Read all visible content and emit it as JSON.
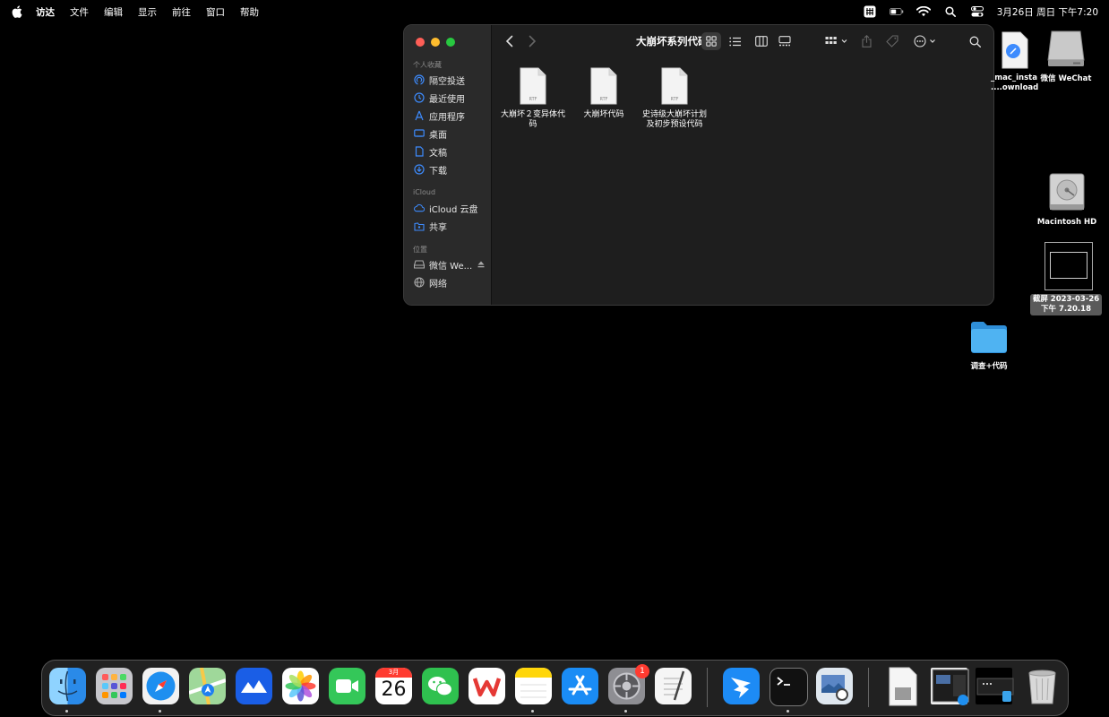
{
  "menubar": {
    "app_name": "访达",
    "menus": [
      "文件",
      "编辑",
      "显示",
      "前往",
      "窗口",
      "帮助"
    ],
    "clock": "3月26日 周日 下午7:20",
    "icons": [
      "apple-icon",
      "input-method-icon",
      "battery-icon",
      "wifi-icon",
      "spotlight-icon",
      "control-center-icon"
    ]
  },
  "finder": {
    "title": "大崩坏系列代码",
    "sidebar": {
      "favorites_header": "个人收藏",
      "favorites": [
        {
          "label": "隔空投送",
          "icon": "airdrop-icon"
        },
        {
          "label": "最近使用",
          "icon": "recents-icon"
        },
        {
          "label": "应用程序",
          "icon": "applications-icon"
        },
        {
          "label": "桌面",
          "icon": "desktop-icon"
        },
        {
          "label": "文稿",
          "icon": "documents-icon"
        },
        {
          "label": "下载",
          "icon": "downloads-icon"
        }
      ],
      "icloud_header": "iCloud",
      "icloud": [
        {
          "label": "iCloud 云盘",
          "icon": "icloud-icon"
        },
        {
          "label": "共享",
          "icon": "shared-folder-icon"
        }
      ],
      "locations_header": "位置",
      "locations": [
        {
          "label": "微信 We...",
          "icon": "disk-icon"
        },
        {
          "label": "网络",
          "icon": "network-icon"
        }
      ]
    },
    "files": [
      {
        "name_line1": "大崩坏２变异体代",
        "name_line2": "码",
        "badge": "RTF"
      },
      {
        "name_line1": "大崩坏代码",
        "name_line2": "",
        "badge": "RTF"
      },
      {
        "name_line1": "史诗级大崩坏计划",
        "name_line2": "及初步预设代码",
        "badge": "RTF"
      }
    ]
  },
  "desktop": {
    "items": [
      {
        "line1": "_mac_insta",
        "line2": "....ownload",
        "icon": "installer-file-icon"
      },
      {
        "line1": "微信 WeChat",
        "line2": "",
        "icon": "drive-icon"
      },
      {
        "line1": "Macintosh HD",
        "line2": "",
        "icon": "hard-disk-icon"
      },
      {
        "line1": "截屏 2023-03-26",
        "line2": "下午 7.20.18",
        "icon": "screenshot-icon"
      },
      {
        "line1": "调查+代码",
        "line2": "",
        "icon": "folder-icon"
      }
    ]
  },
  "dock": {
    "calendar_month": "3月",
    "calendar_day": "26",
    "settings_badge": "1",
    "apps": [
      "finder",
      "launchpad",
      "safari",
      "maps",
      "lark",
      "photos",
      "facetime",
      "calendar",
      "wechat",
      "wps",
      "notes",
      "app-store",
      "system-settings",
      "textedit",
      "dingtalk",
      "terminal",
      "preview"
    ]
  },
  "colors": {
    "close": "#ff5f57",
    "minimize": "#febc2e",
    "zoom": "#28c840",
    "accent": "#3d8bfd",
    "folder": "#3aa3ea"
  }
}
